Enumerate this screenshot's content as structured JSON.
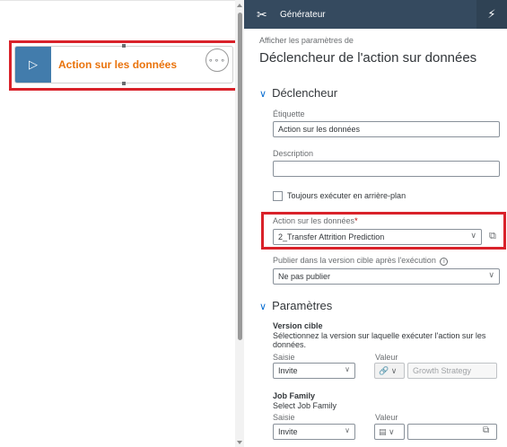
{
  "canvas": {
    "node": {
      "play_icon": "▷",
      "label": "Action sur les données",
      "more_icon": "∘∘∘"
    }
  },
  "panel": {
    "header_title": "Générateur",
    "tools_icon": "✂",
    "wand_icon": "⚡",
    "subtitle": "Afficher les paramètres de",
    "title": "Déclencheur de l'action sur données",
    "trigger": {
      "section_title": "Déclencheur",
      "label_caption": "Étiquette",
      "label_value": "Action sur les données",
      "description_caption": "Description",
      "description_value": "",
      "background_checkbox": "Toujours exécuter en arrière-plan",
      "data_action_caption": "Action sur les données",
      "required_star": "*",
      "data_action_value": "2_Transfer Attrition Prediction",
      "publish_caption": "Publier dans la version cible après l'exécution",
      "info_icon": "i",
      "publish_value": "Ne pas publier"
    },
    "params": {
      "section_title": "Paramètres",
      "version": {
        "title": "Version cible",
        "description": "Sélectionnez la version sur laquelle exécuter l'action sur les données.",
        "saisie_caption": "Saisie",
        "saisie_value": "Invite",
        "valeur_caption": "Valeur",
        "valeur_value": "Growth Strategy"
      },
      "job": {
        "title": "Job Family",
        "description": "Select Job Family",
        "saisie_caption": "Saisie",
        "saisie_value": "Invite",
        "valeur_caption": "Valeur",
        "valeur_value": ""
      }
    }
  },
  "colors": {
    "header": "#354a5f",
    "highlight": "#d9222a",
    "node_label": "#e9730c",
    "node_handle": "#427cac"
  }
}
